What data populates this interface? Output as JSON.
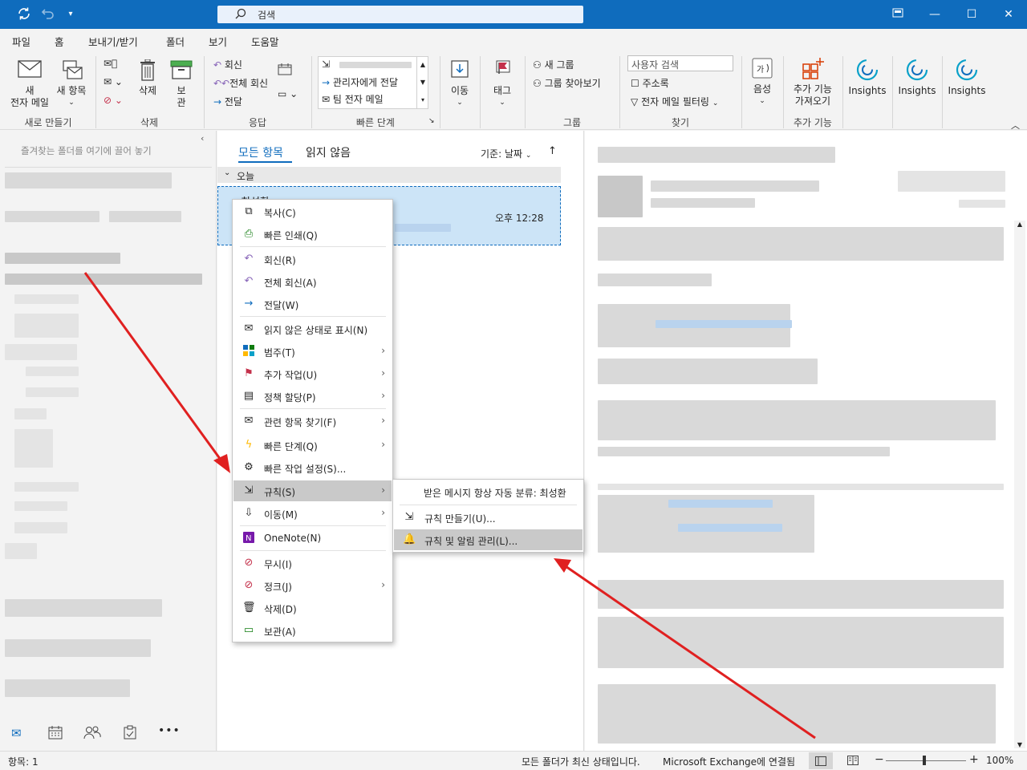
{
  "titlebar": {
    "search_label": "검색"
  },
  "ribbon_tabs": [
    "파일",
    "홈",
    "보내기/받기",
    "폴더",
    "보기",
    "도움말"
  ],
  "ribbon": {
    "new_email": [
      "새",
      "전자 메일"
    ],
    "new_items": "새 항목",
    "delete": "삭제",
    "archive": [
      "보",
      "관"
    ],
    "reply": "회신",
    "reply_all": "전체 회신",
    "forward": "전달",
    "qs_manager": "관리자에게 전달",
    "qs_team": "팀 전자 메일",
    "move": "이동",
    "tags": "태그",
    "new_group": "새 그룹",
    "browse_groups": "그룹 찾아보기",
    "search_people_placeholder": "사용자 검색",
    "address_book": "주소록",
    "filter_email": "전자 메일 필터링",
    "speech": "음성",
    "get_addins": [
      "추가 기능",
      "가져오기"
    ],
    "insights": [
      "Insights",
      "Insights",
      "Insights"
    ],
    "groups": [
      "새로 만들기",
      "삭제",
      "응답",
      "빠른 단계",
      "그룹",
      "찾기",
      "추가 기능"
    ]
  },
  "left_pane": {
    "drop_hint": "즐겨찾는 폴더를 여기에 끌어 놓기"
  },
  "message_list": {
    "filter_all": "모든 항목",
    "filter_unread": "읽지 않음",
    "sort_label": "기준: 날짜",
    "group_today": "오늘",
    "item_sender": "최성환",
    "item_time": "오후 12:28"
  },
  "context_menu": [
    {
      "label": "복사(C)",
      "icon": "copy-icon"
    },
    {
      "label": "빠른 인쇄(Q)",
      "icon": "print-icon"
    },
    {
      "label": "회신(R)",
      "icon": "reply-icon"
    },
    {
      "label": "전체 회신(A)",
      "icon": "reply-all-icon"
    },
    {
      "label": "전달(W)",
      "icon": "forward-icon"
    },
    {
      "label": "읽지 않은 상태로 표시(N)",
      "icon": "envelope-icon"
    },
    {
      "label": "범주(T)",
      "icon": "category-icon"
    },
    {
      "label": "추가 작업(U)",
      "icon": "flag-icon"
    },
    {
      "label": "정책 할당(P)",
      "icon": "policy-icon"
    },
    {
      "label": "관련 항목 찾기(F)",
      "icon": "related-icon"
    },
    {
      "label": "빠른 단계(Q)",
      "icon": "lightning-icon"
    },
    {
      "label": "빠른 작업 설정(S)...",
      "icon": "gear-icon"
    },
    {
      "label": "규칙(S)",
      "icon": "rules-icon"
    },
    {
      "label": "이동(M)",
      "icon": "move-icon"
    },
    {
      "label": "OneNote(N)",
      "icon": "onenote-icon"
    },
    {
      "label": "무시(I)",
      "icon": "ignore-icon"
    },
    {
      "label": "정크(J)",
      "icon": "junk-icon"
    },
    {
      "label": "삭제(D)",
      "icon": "trash-icon"
    },
    {
      "label": "보관(A)",
      "icon": "archive-icon"
    }
  ],
  "submenu": {
    "header": "받은 메시지 항상 자동 분류: 최성환",
    "create_rule": "규칙 만들기(U)...",
    "manage_rules": "규칙 및 알림 관리(L)..."
  },
  "status": {
    "items": "항목: 1",
    "folders": "모든 폴더가 최신 상태입니다.",
    "connection": "Microsoft Exchange에 연결됨",
    "zoom": "100%"
  },
  "colors": {
    "accent": "#0f6cbd",
    "selection": "#cce4f7",
    "arrow": "#e02020"
  }
}
